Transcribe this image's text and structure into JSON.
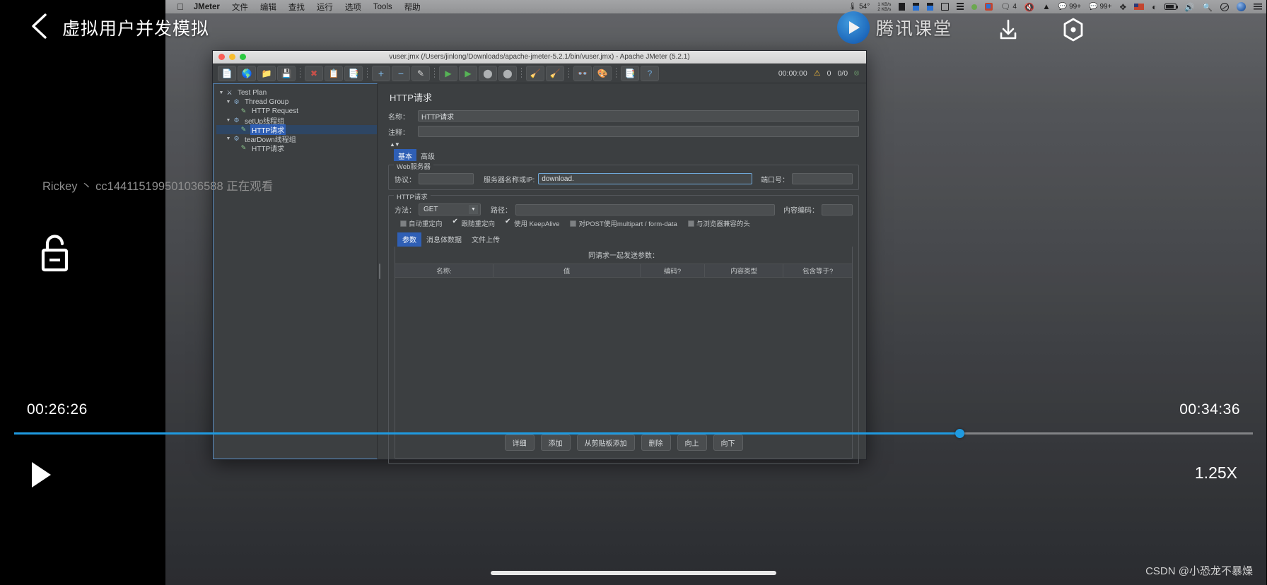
{
  "course": {
    "title": "虚拟用户并发模拟",
    "back_icon": "chevron-left-icon",
    "brand_name": "腾讯课堂",
    "download_icon": "download-icon",
    "settings_icon": "settings-hexagon-icon",
    "viewer_note": "Rickey 丶 cc144115199501036588 正在观看",
    "lock_icon": "unlock-icon",
    "watermark": "CSDN @小恐龙不暴燥"
  },
  "player": {
    "current_time": "00:26:26",
    "total_time": "00:34:36",
    "progress_percent": 76.3,
    "play_icon": "play-icon",
    "speed": "1.25X"
  },
  "menubar": {
    "apple_icon": "apple-icon",
    "items": [
      "JMeter",
      "文件",
      "编辑",
      "查找",
      "运行",
      "选项",
      "Tools",
      "帮助"
    ],
    "status": {
      "temperature": "54°",
      "net_up": "1 KB/s",
      "net_down": "2 KB/s",
      "qq_badge": "4",
      "wechat_badge_1": "99+",
      "wechat_badge_2": "99+"
    }
  },
  "jmeter": {
    "window_title": "vuser.jmx (/Users/jinlong/Downloads/apache-jmeter-5.2.1/bin/vuser.jmx) - Apache JMeter (5.2.1)",
    "toolbar": {
      "buttons": [
        {
          "name": "new-button",
          "glyph": "📄"
        },
        {
          "name": "templates-button",
          "glyph": "🗂"
        },
        {
          "name": "open-button",
          "glyph": "📂"
        },
        {
          "name": "save-button",
          "glyph": "💾"
        },
        {
          "name": "cut-button",
          "glyph": "✂"
        },
        {
          "name": "copy-button",
          "glyph": "📋"
        },
        {
          "name": "paste-button",
          "glyph": "📄"
        },
        {
          "name": "expand-all-button",
          "glyph": "+"
        },
        {
          "name": "collapse-all-button",
          "glyph": "−"
        },
        {
          "name": "toggle-button",
          "glyph": "✎"
        },
        {
          "name": "start-button",
          "glyph": "▶"
        },
        {
          "name": "start-no-pauses-button",
          "glyph": "▶"
        },
        {
          "name": "stop-button",
          "glyph": "⬤"
        },
        {
          "name": "shutdown-button",
          "glyph": "⬤"
        },
        {
          "name": "clear-button",
          "glyph": "🧹"
        },
        {
          "name": "clear-all-button",
          "glyph": "🧹"
        },
        {
          "name": "search-button",
          "glyph": "🔍"
        },
        {
          "name": "reset-search-button",
          "glyph": "🧹"
        },
        {
          "name": "function-helper-button",
          "glyph": "📑"
        },
        {
          "name": "help-button",
          "glyph": "?"
        }
      ],
      "timer": "00:00:00",
      "warning_icon": "warning-triangle-icon",
      "warning_count": "0",
      "thread_counter": "0/0",
      "connect_icon": "target-icon"
    },
    "tree": [
      {
        "label": "Test Plan",
        "depth": 0,
        "icon": "test-plan-icon",
        "expanded": true,
        "selected": false
      },
      {
        "label": "Thread Group",
        "depth": 1,
        "icon": "thread-group-icon",
        "expanded": true,
        "selected": false
      },
      {
        "label": "HTTP Request",
        "depth": 2,
        "icon": "http-request-icon",
        "expanded": false,
        "selected": false
      },
      {
        "label": "setUp线程组",
        "depth": 1,
        "icon": "thread-group-icon",
        "expanded": true,
        "selected": false
      },
      {
        "label": "HTTP请求",
        "depth": 2,
        "icon": "http-request-icon",
        "expanded": false,
        "selected": true
      },
      {
        "label": "tearDown线程组",
        "depth": 1,
        "icon": "thread-group-icon",
        "expanded": true,
        "selected": false
      },
      {
        "label": "HTTP请求",
        "depth": 2,
        "icon": "http-request-icon",
        "expanded": false,
        "selected": false
      }
    ],
    "panel": {
      "title": "HTTP请求",
      "name_label": "名称：",
      "name_value": "HTTP请求",
      "comment_label": "注释：",
      "comment_value": "",
      "tabs": [
        {
          "label": "基本",
          "active": true
        },
        {
          "label": "高级",
          "active": false
        }
      ],
      "web_server": {
        "legend": "Web服务器",
        "protocol_label": "协议：",
        "protocol_value": "",
        "server_label": "服务器名称或IP:",
        "server_value": "download.",
        "port_label": "端口号：",
        "port_value": ""
      },
      "http_request": {
        "legend": "HTTP请求",
        "method_label": "方法：",
        "method_value": "GET",
        "path_label": "路径：",
        "path_value": "",
        "encoding_label": "内容编码：",
        "encoding_value": "",
        "checkboxes": [
          {
            "label": "自动重定向",
            "checked": false
          },
          {
            "label": "跟随重定向",
            "checked": true
          },
          {
            "label": "使用 KeepAlive",
            "checked": true
          },
          {
            "label": "对POST使用multipart / form-data",
            "checked": false
          },
          {
            "label": "与浏览器兼容的头",
            "checked": false
          }
        ]
      },
      "param_tabs": [
        {
          "label": "参数",
          "active": true
        },
        {
          "label": "消息体数据",
          "active": false
        },
        {
          "label": "文件上传",
          "active": false
        }
      ],
      "params_title": "同请求一起发送参数：",
      "params_columns": [
        "名称:",
        "值",
        "编码?",
        "内容类型",
        "包含等于?"
      ],
      "bottom_buttons": [
        "详细",
        "添加",
        "从剪贴板添加",
        "删除",
        "向上",
        "向下"
      ]
    }
  }
}
